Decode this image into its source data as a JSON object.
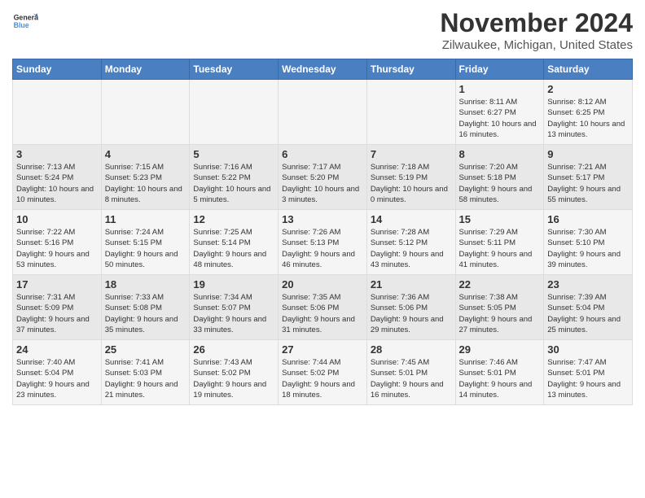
{
  "logo": {
    "text_general": "General",
    "text_blue": "Blue"
  },
  "title": "November 2024",
  "subtitle": "Zilwaukee, Michigan, United States",
  "weekdays": [
    "Sunday",
    "Monday",
    "Tuesday",
    "Wednesday",
    "Thursday",
    "Friday",
    "Saturday"
  ],
  "weeks": [
    [
      {
        "day": "",
        "info": ""
      },
      {
        "day": "",
        "info": ""
      },
      {
        "day": "",
        "info": ""
      },
      {
        "day": "",
        "info": ""
      },
      {
        "day": "",
        "info": ""
      },
      {
        "day": "1",
        "info": "Sunrise: 8:11 AM\nSunset: 6:27 PM\nDaylight: 10 hours and 16 minutes."
      },
      {
        "day": "2",
        "info": "Sunrise: 8:12 AM\nSunset: 6:25 PM\nDaylight: 10 hours and 13 minutes."
      }
    ],
    [
      {
        "day": "3",
        "info": "Sunrise: 7:13 AM\nSunset: 5:24 PM\nDaylight: 10 hours and 10 minutes."
      },
      {
        "day": "4",
        "info": "Sunrise: 7:15 AM\nSunset: 5:23 PM\nDaylight: 10 hours and 8 minutes."
      },
      {
        "day": "5",
        "info": "Sunrise: 7:16 AM\nSunset: 5:22 PM\nDaylight: 10 hours and 5 minutes."
      },
      {
        "day": "6",
        "info": "Sunrise: 7:17 AM\nSunset: 5:20 PM\nDaylight: 10 hours and 3 minutes."
      },
      {
        "day": "7",
        "info": "Sunrise: 7:18 AM\nSunset: 5:19 PM\nDaylight: 10 hours and 0 minutes."
      },
      {
        "day": "8",
        "info": "Sunrise: 7:20 AM\nSunset: 5:18 PM\nDaylight: 9 hours and 58 minutes."
      },
      {
        "day": "9",
        "info": "Sunrise: 7:21 AM\nSunset: 5:17 PM\nDaylight: 9 hours and 55 minutes."
      }
    ],
    [
      {
        "day": "10",
        "info": "Sunrise: 7:22 AM\nSunset: 5:16 PM\nDaylight: 9 hours and 53 minutes."
      },
      {
        "day": "11",
        "info": "Sunrise: 7:24 AM\nSunset: 5:15 PM\nDaylight: 9 hours and 50 minutes."
      },
      {
        "day": "12",
        "info": "Sunrise: 7:25 AM\nSunset: 5:14 PM\nDaylight: 9 hours and 48 minutes."
      },
      {
        "day": "13",
        "info": "Sunrise: 7:26 AM\nSunset: 5:13 PM\nDaylight: 9 hours and 46 minutes."
      },
      {
        "day": "14",
        "info": "Sunrise: 7:28 AM\nSunset: 5:12 PM\nDaylight: 9 hours and 43 minutes."
      },
      {
        "day": "15",
        "info": "Sunrise: 7:29 AM\nSunset: 5:11 PM\nDaylight: 9 hours and 41 minutes."
      },
      {
        "day": "16",
        "info": "Sunrise: 7:30 AM\nSunset: 5:10 PM\nDaylight: 9 hours and 39 minutes."
      }
    ],
    [
      {
        "day": "17",
        "info": "Sunrise: 7:31 AM\nSunset: 5:09 PM\nDaylight: 9 hours and 37 minutes."
      },
      {
        "day": "18",
        "info": "Sunrise: 7:33 AM\nSunset: 5:08 PM\nDaylight: 9 hours and 35 minutes."
      },
      {
        "day": "19",
        "info": "Sunrise: 7:34 AM\nSunset: 5:07 PM\nDaylight: 9 hours and 33 minutes."
      },
      {
        "day": "20",
        "info": "Sunrise: 7:35 AM\nSunset: 5:06 PM\nDaylight: 9 hours and 31 minutes."
      },
      {
        "day": "21",
        "info": "Sunrise: 7:36 AM\nSunset: 5:06 PM\nDaylight: 9 hours and 29 minutes."
      },
      {
        "day": "22",
        "info": "Sunrise: 7:38 AM\nSunset: 5:05 PM\nDaylight: 9 hours and 27 minutes."
      },
      {
        "day": "23",
        "info": "Sunrise: 7:39 AM\nSunset: 5:04 PM\nDaylight: 9 hours and 25 minutes."
      }
    ],
    [
      {
        "day": "24",
        "info": "Sunrise: 7:40 AM\nSunset: 5:04 PM\nDaylight: 9 hours and 23 minutes."
      },
      {
        "day": "25",
        "info": "Sunrise: 7:41 AM\nSunset: 5:03 PM\nDaylight: 9 hours and 21 minutes."
      },
      {
        "day": "26",
        "info": "Sunrise: 7:43 AM\nSunset: 5:02 PM\nDaylight: 9 hours and 19 minutes."
      },
      {
        "day": "27",
        "info": "Sunrise: 7:44 AM\nSunset: 5:02 PM\nDaylight: 9 hours and 18 minutes."
      },
      {
        "day": "28",
        "info": "Sunrise: 7:45 AM\nSunset: 5:01 PM\nDaylight: 9 hours and 16 minutes."
      },
      {
        "day": "29",
        "info": "Sunrise: 7:46 AM\nSunset: 5:01 PM\nDaylight: 9 hours and 14 minutes."
      },
      {
        "day": "30",
        "info": "Sunrise: 7:47 AM\nSunset: 5:01 PM\nDaylight: 9 hours and 13 minutes."
      }
    ]
  ]
}
